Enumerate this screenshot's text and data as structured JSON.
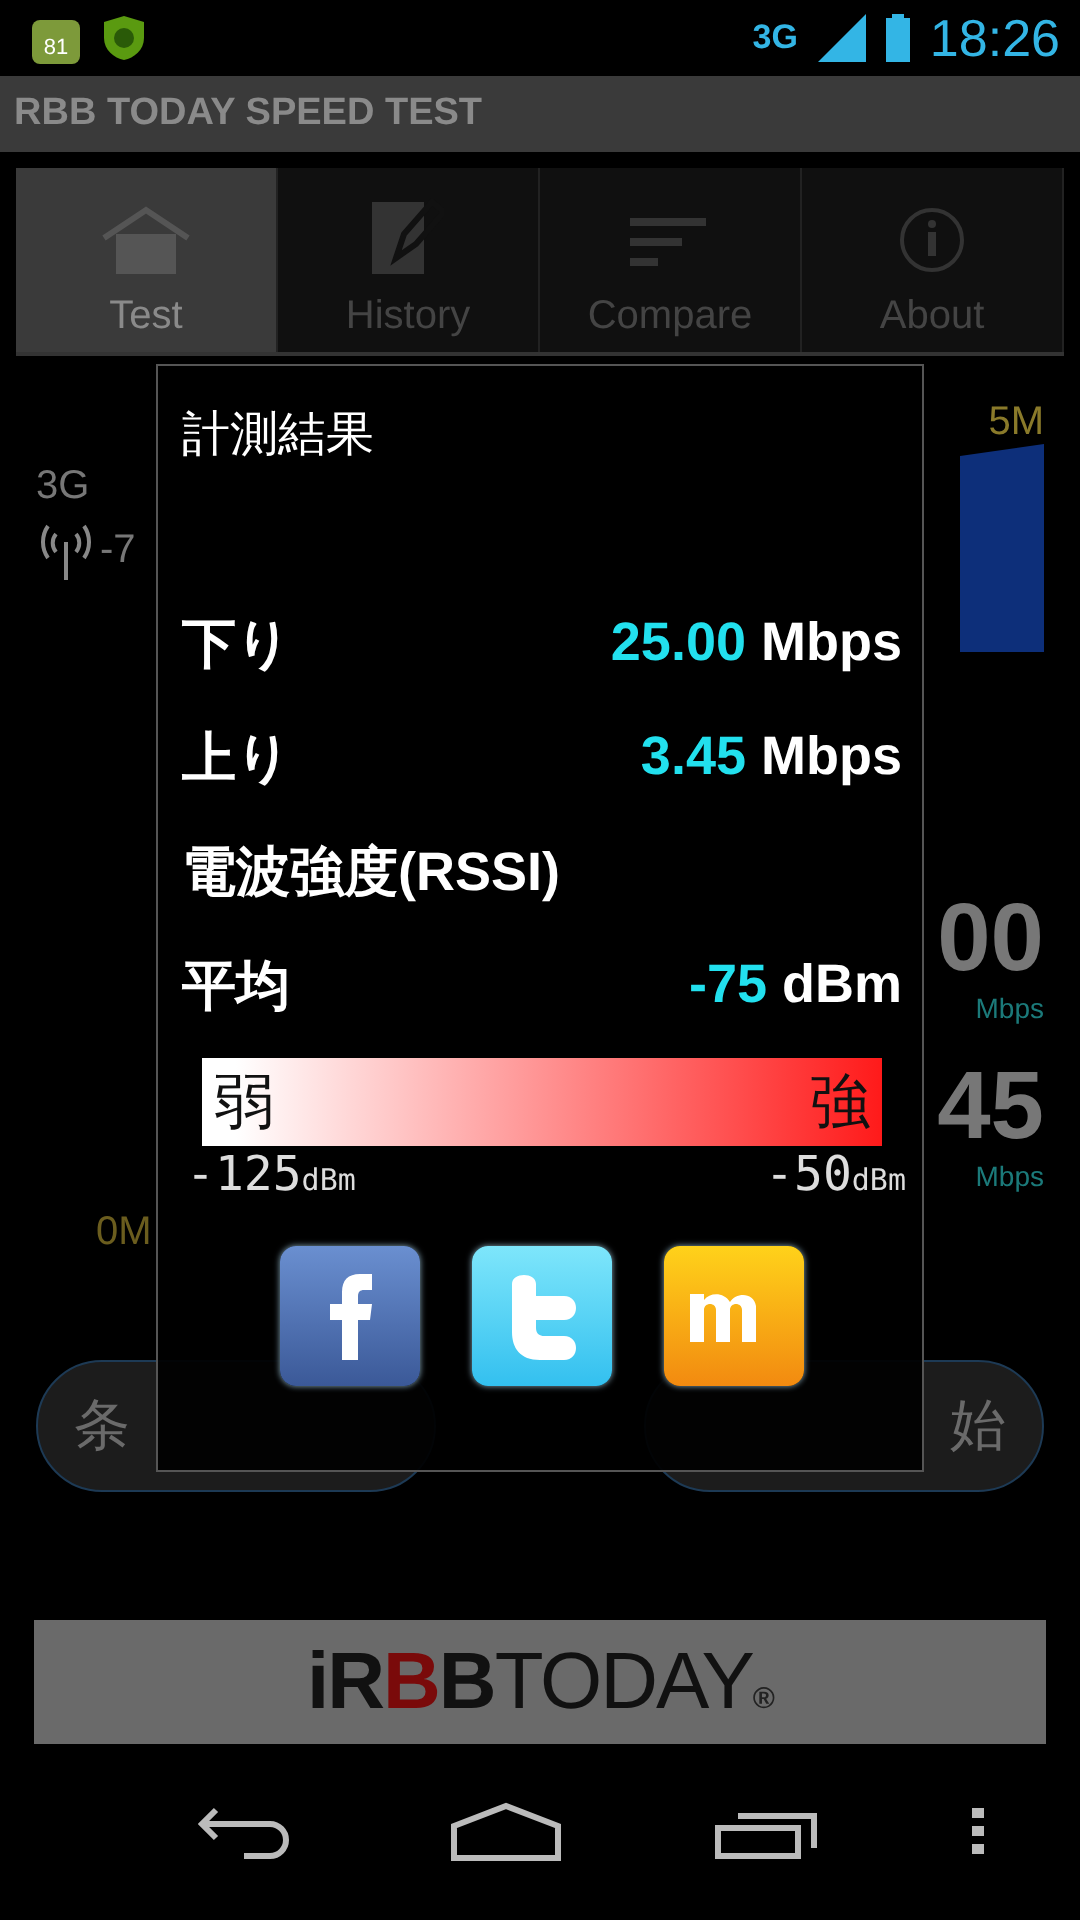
{
  "status_bar": {
    "notifications": [
      {
        "kind": "badge",
        "label": "81"
      },
      {
        "kind": "shield"
      }
    ],
    "network": "3G",
    "time": "18:26"
  },
  "app_title": "RBB TODAY SPEED TEST",
  "tabs": [
    {
      "label": "Test",
      "kind": "home",
      "selected": true
    },
    {
      "label": "History",
      "kind": "edit",
      "selected": false
    },
    {
      "label": "Compare",
      "kind": "lines",
      "selected": false
    },
    {
      "label": "About",
      "kind": "info",
      "selected": false
    }
  ],
  "background": {
    "network_type": "3G",
    "signal": "-7",
    "scale_max": "5M",
    "scale_min": "0M",
    "download_value": "00",
    "download_unit": "Mbps",
    "upload_value": "45",
    "upload_unit": "Mbps",
    "buttons": [
      "条",
      "始"
    ]
  },
  "dialog": {
    "title": "計測結果",
    "rows": [
      {
        "label": "下り",
        "value": "25.00",
        "unit": "Mbps"
      },
      {
        "label": "上り",
        "value": "3.45",
        "unit": "Mbps"
      }
    ],
    "section": "電波強度(RSSI)",
    "average": {
      "label": "平均",
      "value": "-75",
      "unit": "dBm"
    },
    "meter": {
      "weak": "弱",
      "strong": "強",
      "min_value": "-125",
      "min_unit": "dBm",
      "max_value": "-50",
      "max_unit": "dBm"
    },
    "share": [
      {
        "kind": "facebook"
      },
      {
        "kind": "twitter"
      },
      {
        "kind": "mixi"
      }
    ]
  },
  "banner": {
    "logo": [
      {
        "text": "i",
        "color": "#111111"
      },
      {
        "text": "R",
        "color": "#111111"
      },
      {
        "text": "B",
        "color": "#7a0a0a"
      },
      {
        "text": "B",
        "color": "#111111"
      },
      {
        "text": "TODAY",
        "color": "#111111"
      }
    ],
    "mark": "®"
  }
}
